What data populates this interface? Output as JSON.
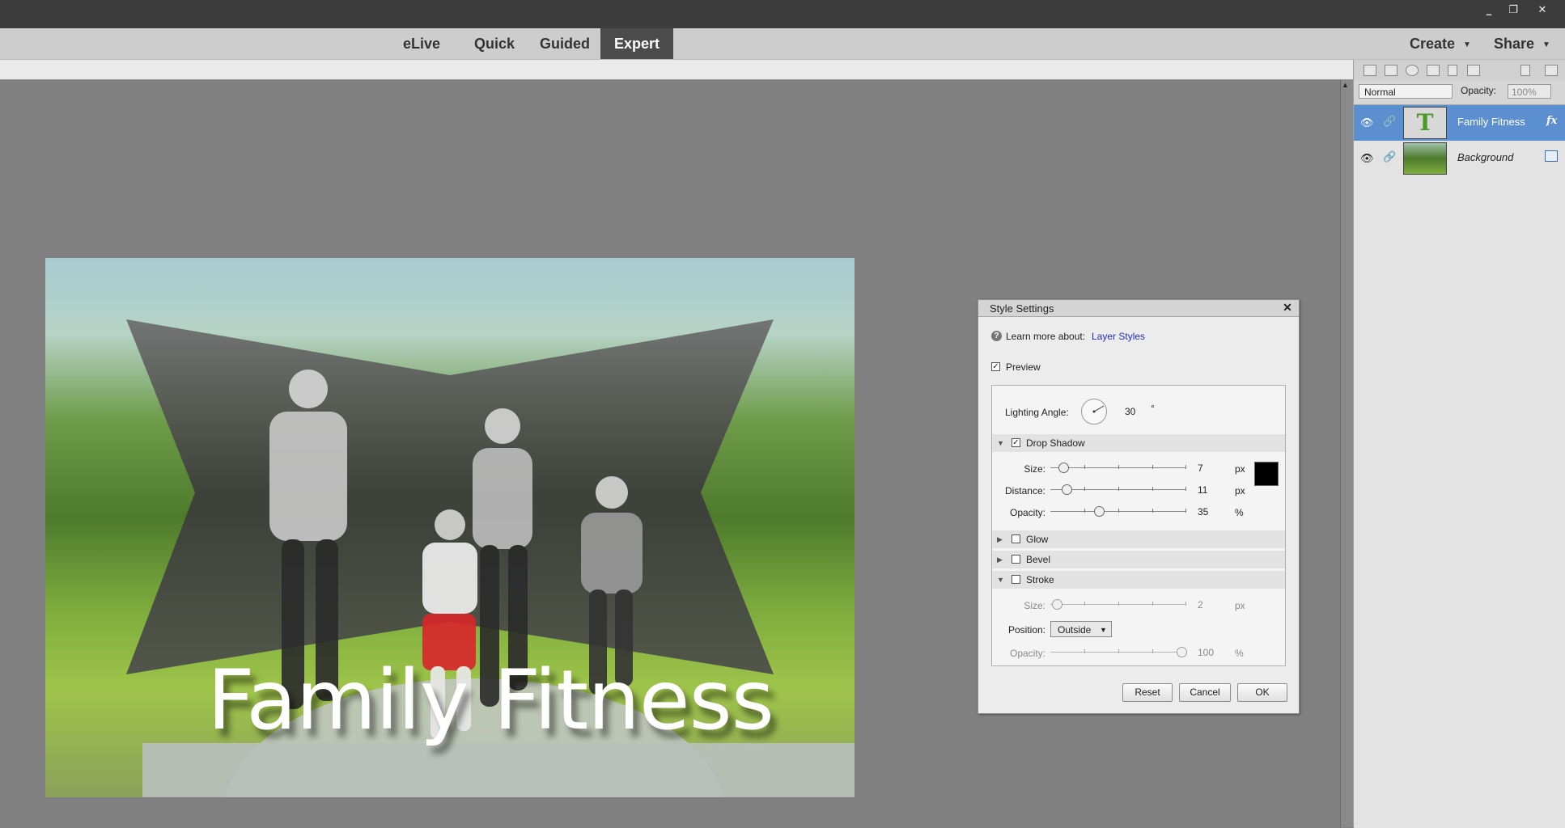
{
  "window": {
    "minimize": "_",
    "restore": "❐",
    "close": "✕"
  },
  "modes": {
    "elive": "eLive",
    "quick": "Quick",
    "guided": "Guided",
    "expert": "Expert"
  },
  "top_actions": {
    "create": "Create",
    "share": "Share",
    "caret": "▼"
  },
  "layers_panel": {
    "blend_mode": "Normal",
    "opacity_label": "Opacity:",
    "opacity_value": "100%",
    "layers": [
      {
        "name": "Family Fitness",
        "type": "text",
        "thumb_glyph": "T",
        "fx": "fx",
        "selected": true
      },
      {
        "name": "Background",
        "type": "image",
        "selected": false
      }
    ]
  },
  "canvas": {
    "text_layer": "Family Fitness"
  },
  "dialog": {
    "title": "Style Settings",
    "close": "✕",
    "help_icon": "?",
    "learn_more": "Learn more about:",
    "learn_link": "Layer Styles",
    "preview_label": "Preview",
    "preview_checked": true,
    "lighting_label": "Lighting Angle:",
    "lighting_angle": "30",
    "degree": "°",
    "drop_shadow": {
      "label": "Drop Shadow",
      "checked": true,
      "size_label": "Size:",
      "size": "7",
      "size_unit": "px",
      "distance_label": "Distance:",
      "distance": "11",
      "distance_unit": "px",
      "opacity_label": "Opacity:",
      "opacity": "35",
      "opacity_unit": "%",
      "color": "#000000"
    },
    "glow": {
      "label": "Glow",
      "checked": false
    },
    "bevel": {
      "label": "Bevel",
      "checked": false
    },
    "stroke": {
      "label": "Stroke",
      "checked": false,
      "size_label": "Size:",
      "size": "2",
      "size_unit": "px",
      "position_label": "Position:",
      "position": "Outside",
      "opacity_label": "Opacity:",
      "opacity": "100",
      "opacity_unit": "%"
    },
    "buttons": {
      "reset": "Reset",
      "cancel": "Cancel",
      "ok": "OK"
    }
  },
  "colors": {
    "selected_layer": "#5b8fcf",
    "link": "#2230b8",
    "active_mode": "#4b4b4b"
  }
}
